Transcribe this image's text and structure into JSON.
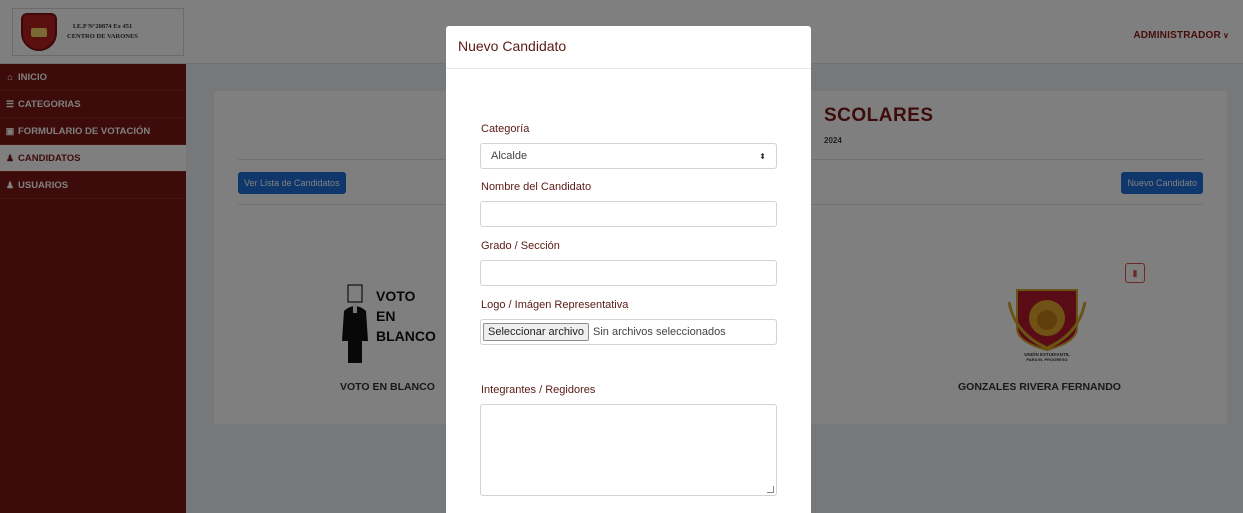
{
  "header": {
    "school_line1": "I.E.P N°20874 Ex 451",
    "school_line2": "CENTRO DE VARONES",
    "user_menu": "ADMINISTRADOR",
    "chevron_icon": "chevron-down-icon"
  },
  "sidebar": {
    "items": [
      {
        "label": "INICIO",
        "icon": "home-icon",
        "glyph": "⌂",
        "active": false
      },
      {
        "label": "CATEGORIAS",
        "icon": "list-icon",
        "glyph": "☰",
        "active": false
      },
      {
        "label": "FORMULARIO DE VOTACIÓN",
        "icon": "form-icon",
        "glyph": "▣",
        "active": false
      },
      {
        "label": "CANDIDATOS",
        "icon": "users-icon",
        "glyph": "♟",
        "active": true
      },
      {
        "label": "USUARIOS",
        "icon": "group-icon",
        "glyph": "♟",
        "active": false
      }
    ]
  },
  "main": {
    "title_visible": "SCOLARES",
    "subtitle_visible": "2024",
    "list_button": "Ver Lista de Candidatos",
    "new_button": "Nuevo Candidato",
    "candidates": [
      {
        "name": "VOTO EN BLANCO",
        "image_text": [
          "VOTO",
          "EN",
          "BLANCO"
        ]
      },
      {
        "name": "GONZALES RIVERA FERNANDO",
        "image_text": [
          "UNIÓN ESTUDIANTIL",
          "PARA EL PROGRESO"
        ]
      }
    ],
    "delete_icon": "trash-icon"
  },
  "modal": {
    "title": "Nuevo Candidato",
    "category_label": "Categoría",
    "category_value": "Alcalde",
    "name_label": "Nombre del Candidato",
    "name_value": "",
    "grade_label": "Grado / Sección",
    "grade_value": "",
    "logo_label": "Logo / Imágen Representativa",
    "file_button": "Seleccionar archivo",
    "file_status": "Sin archivos seleccionados",
    "members_label": "Integrantes / Regidores",
    "members_value": ""
  },
  "colors": {
    "brand": "#7a1712",
    "primary_button": "#1f6fd6",
    "danger": "#d9534f"
  }
}
